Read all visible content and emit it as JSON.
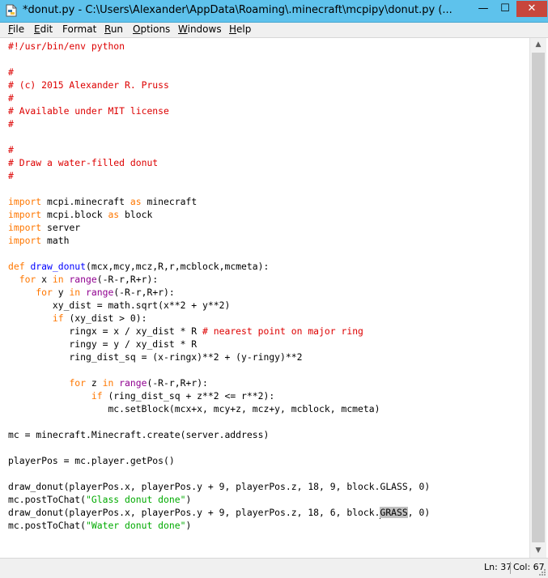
{
  "window": {
    "title": "*donut.py - C:\\Users\\Alexander\\AppData\\Roaming\\.minecraft\\mcpipy\\donut.py (...",
    "minimize_glyph": "—",
    "maximize_glyph": "☐",
    "close_glyph": "✕",
    "icon": "python-idle-file-icon"
  },
  "menu": [
    {
      "u": "F",
      "r": "ile"
    },
    {
      "u": "E",
      "r": "dit"
    },
    {
      "u": "",
      "r": "Format"
    },
    {
      "u": "R",
      "r": "un"
    },
    {
      "u": "O",
      "r": "ptions"
    },
    {
      "u": "W",
      "r": "indows"
    },
    {
      "u": "H",
      "r": "elp"
    }
  ],
  "colors": {
    "keyword": "#ff7700",
    "builtin": "#900090",
    "comment": "#dd0000",
    "string": "#00aa00",
    "definition": "#0000ff",
    "selection": "#c0c0c0",
    "titlebar": "#5ec2ec",
    "close_button": "#c7463c"
  },
  "code": [
    [
      {
        "t": "#!/usr/bin/env python",
        "c": "cm"
      }
    ],
    [],
    [
      {
        "t": "#",
        "c": "cm"
      }
    ],
    [
      {
        "t": "# (c) 2015 Alexander R. Pruss",
        "c": "cm"
      }
    ],
    [
      {
        "t": "#",
        "c": "cm"
      }
    ],
    [
      {
        "t": "# Available under MIT license",
        "c": "cm"
      }
    ],
    [
      {
        "t": "#",
        "c": "cm"
      }
    ],
    [],
    [
      {
        "t": "#",
        "c": "cm"
      }
    ],
    [
      {
        "t": "# Draw a water-filled donut",
        "c": "cm"
      }
    ],
    [
      {
        "t": "#",
        "c": "cm"
      }
    ],
    [],
    [
      {
        "t": "import",
        "c": "kw"
      },
      {
        "t": " mcpi.minecraft "
      },
      {
        "t": "as",
        "c": "kw"
      },
      {
        "t": " minecraft"
      }
    ],
    [
      {
        "t": "import",
        "c": "kw"
      },
      {
        "t": " mcpi.block "
      },
      {
        "t": "as",
        "c": "kw"
      },
      {
        "t": " block"
      }
    ],
    [
      {
        "t": "import",
        "c": "kw"
      },
      {
        "t": " server"
      }
    ],
    [
      {
        "t": "import",
        "c": "kw"
      },
      {
        "t": " math"
      }
    ],
    [],
    [
      {
        "t": "def",
        "c": "kw"
      },
      {
        "t": " "
      },
      {
        "t": "draw_donut",
        "c": "df"
      },
      {
        "t": "(mcx,mcy,mcz,R,r,mcblock,mcmeta):"
      }
    ],
    [
      {
        "t": "  "
      },
      {
        "t": "for",
        "c": "kw"
      },
      {
        "t": " x "
      },
      {
        "t": "in",
        "c": "kw"
      },
      {
        "t": " "
      },
      {
        "t": "range",
        "c": "bi"
      },
      {
        "t": "(-R-r,R+r):"
      }
    ],
    [
      {
        "t": "     "
      },
      {
        "t": "for",
        "c": "kw"
      },
      {
        "t": " y "
      },
      {
        "t": "in",
        "c": "kw"
      },
      {
        "t": " "
      },
      {
        "t": "range",
        "c": "bi"
      },
      {
        "t": "(-R-r,R+r):"
      }
    ],
    [
      {
        "t": "        xy_dist = math.sqrt(x**2 + y**2)"
      }
    ],
    [
      {
        "t": "        "
      },
      {
        "t": "if",
        "c": "kw"
      },
      {
        "t": " (xy_dist > 0):"
      }
    ],
    [
      {
        "t": "           ringx = x / xy_dist * R "
      },
      {
        "t": "# nearest point on major ring",
        "c": "cm"
      }
    ],
    [
      {
        "t": "           ringy = y / xy_dist * R"
      }
    ],
    [
      {
        "t": "           ring_dist_sq = (x-ringx)**2 + (y-ringy)**2"
      }
    ],
    [],
    [
      {
        "t": "           "
      },
      {
        "t": "for",
        "c": "kw"
      },
      {
        "t": " z "
      },
      {
        "t": "in",
        "c": "kw"
      },
      {
        "t": " "
      },
      {
        "t": "range",
        "c": "bi"
      },
      {
        "t": "(-R-r,R+r):"
      }
    ],
    [
      {
        "t": "               "
      },
      {
        "t": "if",
        "c": "kw"
      },
      {
        "t": " (ring_dist_sq + z**2 <= r**2):"
      }
    ],
    [
      {
        "t": "                  mc.setBlock(mcx+x, mcy+z, mcz+y, mcblock, mcmeta)"
      }
    ],
    [],
    [
      {
        "t": "mc = minecraft.Minecraft.create(server.address)"
      }
    ],
    [],
    [
      {
        "t": "playerPos = mc.player.getPos()"
      }
    ],
    [],
    [
      {
        "t": "draw_donut(playerPos.x, playerPos.y + 9, playerPos.z, 18, 9, block.GLASS, 0)"
      }
    ],
    [
      {
        "t": "mc.postToChat("
      },
      {
        "t": "\"Glass donut done\"",
        "c": "st"
      },
      {
        "t": ")"
      }
    ],
    [
      {
        "t": "draw_donut(playerPos.x, playerPos.y + 9, playerPos.z, 18, 6, block."
      },
      {
        "t": "",
        "c": "cursor"
      },
      {
        "t": "GRASS",
        "c": "sel"
      },
      {
        "t": ", 0)"
      }
    ],
    [
      {
        "t": "mc.postToChat("
      },
      {
        "t": "\"Water donut done\"",
        "c": "st"
      },
      {
        "t": ")"
      }
    ]
  ],
  "status": {
    "line": "Ln: 37",
    "col": "Col: 67"
  }
}
